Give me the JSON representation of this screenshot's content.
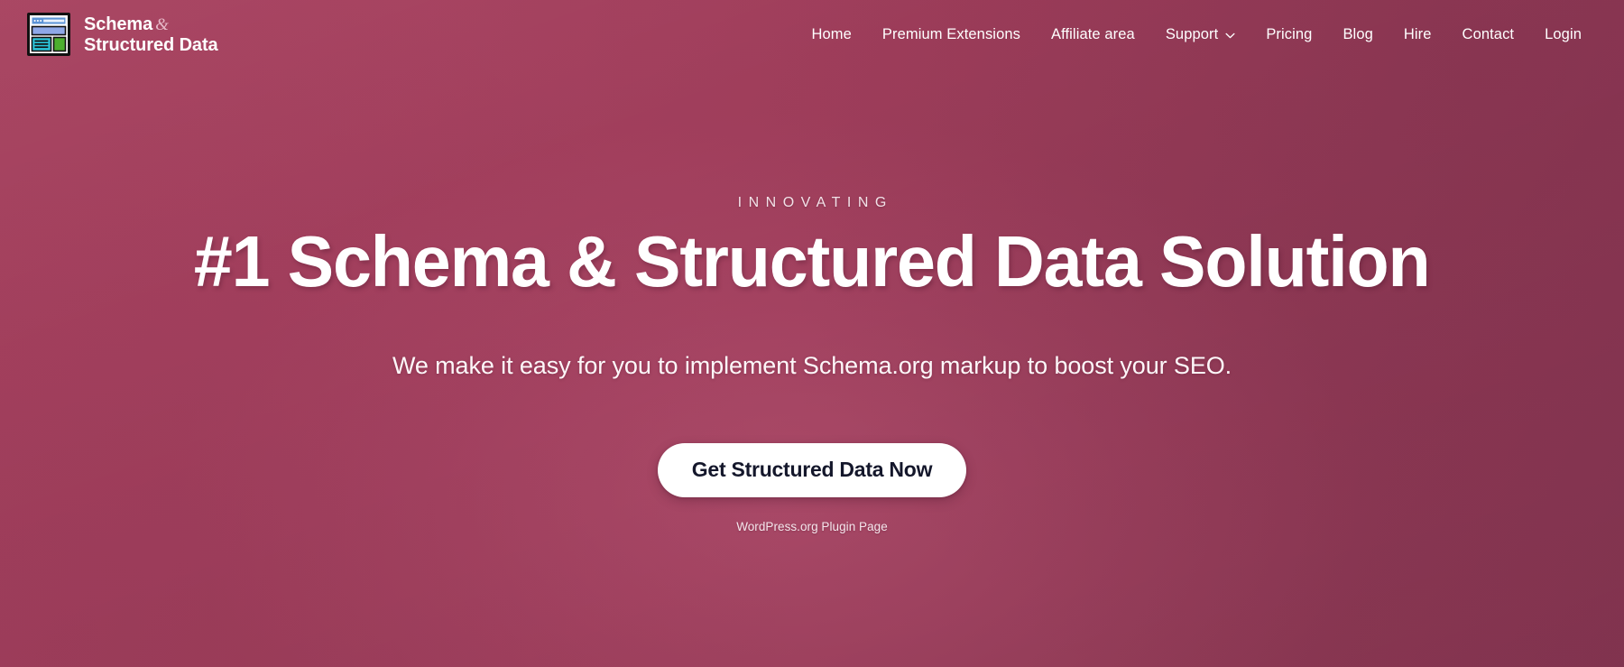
{
  "brand": {
    "line1": "Schema",
    "ampersand": "&",
    "line2": "Structured Data",
    "icon": "browser-window-logo-icon"
  },
  "nav": {
    "items": [
      {
        "label": "Home",
        "has_dropdown": false
      },
      {
        "label": "Premium Extensions",
        "has_dropdown": false
      },
      {
        "label": "Affiliate area",
        "has_dropdown": false
      },
      {
        "label": "Support",
        "has_dropdown": true,
        "dropdown_icon": "chevron-down-icon"
      },
      {
        "label": "Pricing",
        "has_dropdown": false
      },
      {
        "label": "Blog",
        "has_dropdown": false
      },
      {
        "label": "Hire",
        "has_dropdown": false
      },
      {
        "label": "Contact",
        "has_dropdown": false
      },
      {
        "label": "Login",
        "has_dropdown": false
      }
    ]
  },
  "hero": {
    "eyebrow": "INNOVATING",
    "title": "#1 Schema & Structured Data Solution",
    "subtitle": "We make it easy for you to implement Schema.org markup to boost your SEO.",
    "cta_label": "Get Structured Data Now",
    "cta_note": "WordPress.org Plugin Page"
  },
  "colors": {
    "background_light": "#a8425f",
    "background_dark": "#883653",
    "text_on_hero": "#ffffff",
    "cta_background": "#ffffff",
    "cta_text": "#14172b",
    "ampersand": "#e7b9c8",
    "logo_header_bar": "#5b93d6",
    "logo_banner": "#8fa8e8",
    "logo_content_block": "#2bc4d8",
    "logo_side_block": "#4caf2e",
    "logo_outline": "#111111",
    "logo_paper": "#ffffff"
  }
}
